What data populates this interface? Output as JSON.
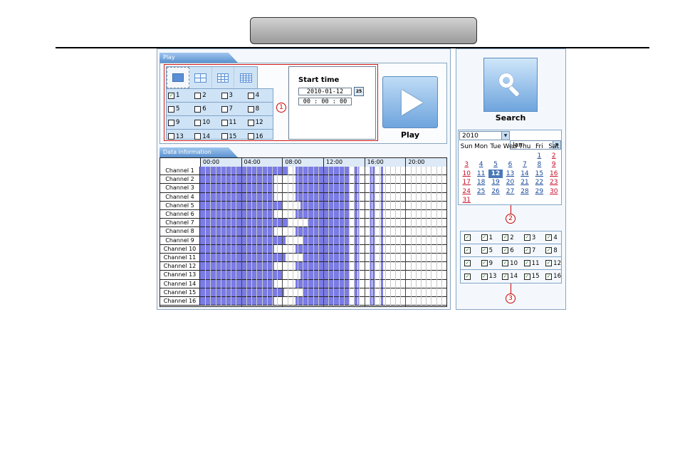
{
  "play_panel": {
    "tab_label": "Play"
  },
  "layout_options": [
    {
      "icon": "single-view-icon"
    },
    {
      "icon": "quad-view-icon"
    },
    {
      "icon": "nine-view-icon"
    },
    {
      "icon": "sixteen-view-icon"
    }
  ],
  "play_channels": [
    [
      {
        "label": "1",
        "checked": true
      },
      {
        "label": "2",
        "checked": false
      },
      {
        "label": "3",
        "checked": false
      },
      {
        "label": "4",
        "checked": false
      }
    ],
    [
      {
        "label": "5",
        "checked": false
      },
      {
        "label": "6",
        "checked": false
      },
      {
        "label": "7",
        "checked": false
      },
      {
        "label": "8",
        "checked": false
      }
    ],
    [
      {
        "label": "9",
        "checked": false
      },
      {
        "label": "10",
        "checked": false
      },
      {
        "label": "11",
        "checked": false
      },
      {
        "label": "12",
        "checked": false
      }
    ],
    [
      {
        "label": "13",
        "checked": false
      },
      {
        "label": "14",
        "checked": false
      },
      {
        "label": "15",
        "checked": false
      },
      {
        "label": "16",
        "checked": false
      }
    ]
  ],
  "start_time": {
    "title": "Start time",
    "date": "2010-01-12",
    "time": "00 : 00 : 00",
    "calendar_icon_label": "25"
  },
  "play_button": {
    "label": "Play"
  },
  "markers": {
    "one": "1",
    "two": "2",
    "three": "3"
  },
  "data_panel": {
    "tab_label": "Data information"
  },
  "timeline": {
    "hour_labels": [
      "00:00",
      "04:00",
      "08:00",
      "12:00",
      "16:00",
      "20:00"
    ],
    "channels": [
      "Channel 1",
      "Channel 2",
      "Channel 3",
      "Channel 4",
      "Channel 5",
      "Channel 6",
      "Channel 7",
      "Channel 8",
      "Channel 9",
      "Channel 10",
      "Channel 11",
      "Channel 12",
      "Channel 13",
      "Channel 14",
      "Channel 15",
      "Channel 16"
    ],
    "colors": {
      "record": "#7b7be6",
      "normal": "#ffffff"
    }
  },
  "search": {
    "label": "Search"
  },
  "calendar": {
    "year": "2010",
    "month": "Jan",
    "weekdays": [
      "Sun",
      "Mon",
      "Tue",
      "Wed",
      "Thu",
      "Fri",
      "Sat"
    ],
    "cells": [
      "",
      "",
      "",
      "",
      "",
      "1",
      "2",
      "3",
      "4",
      "5",
      "6",
      "7",
      "8",
      "9",
      "10",
      "11",
      "12",
      "13",
      "14",
      "15",
      "16",
      "17",
      "18",
      "19",
      "20",
      "21",
      "22",
      "23",
      "24",
      "25",
      "26",
      "27",
      "28",
      "29",
      "30",
      "31",
      "",
      "",
      "",
      "",
      "",
      ""
    ],
    "selected": "12"
  },
  "search_channels": [
    [
      {
        "label": "",
        "checked": true
      },
      {
        "label": "1",
        "checked": true
      },
      {
        "label": "2",
        "checked": true
      },
      {
        "label": "3",
        "checked": true
      },
      {
        "label": "4",
        "checked": true
      }
    ],
    [
      {
        "label": "",
        "checked": true
      },
      {
        "label": "5",
        "checked": true
      },
      {
        "label": "6",
        "checked": true
      },
      {
        "label": "7",
        "checked": true
      },
      {
        "label": "8",
        "checked": true
      }
    ],
    [
      {
        "label": "",
        "checked": true
      },
      {
        "label": "9",
        "checked": true
      },
      {
        "label": "10",
        "checked": true
      },
      {
        "label": "11",
        "checked": true
      },
      {
        "label": "12",
        "checked": true
      }
    ],
    [
      {
        "label": "",
        "checked": true
      },
      {
        "label": "13",
        "checked": true
      },
      {
        "label": "14",
        "checked": true
      },
      {
        "label": "15",
        "checked": true
      },
      {
        "label": "16",
        "checked": true
      }
    ]
  ]
}
